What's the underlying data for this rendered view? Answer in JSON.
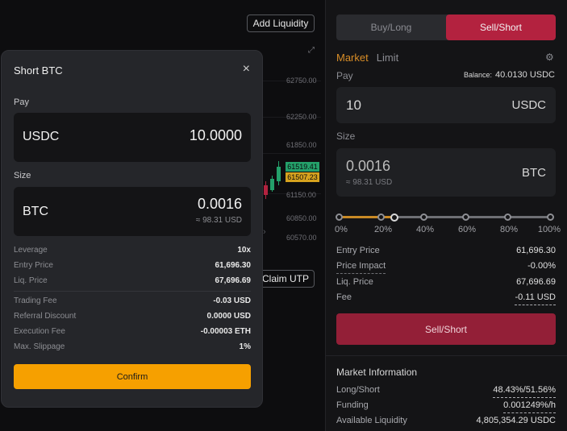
{
  "background": {
    "add_liquidity": "Add Liquidity",
    "claim_utp": "Claim UTP",
    "price_ticks": [
      "62750.00",
      "62250.00",
      "61850.00",
      "61150.00",
      "60850.00",
      "60570.00"
    ],
    "tag_green": "61519.41",
    "tag_orange": "61507.23",
    "expand_icon": "expand-icon",
    "chevron": "›"
  },
  "modal": {
    "title": "Short BTC",
    "close_icon": "×",
    "pay_label": "Pay",
    "pay_currency": "USDC",
    "pay_amount": "10.0000",
    "size_label": "Size",
    "size_currency": "BTC",
    "size_amount": "0.0016",
    "size_usd": "≈ 98.31 USD",
    "rows_a": [
      {
        "label": "Leverage",
        "value": "10x"
      },
      {
        "label": "Entry Price",
        "value": "61,696.30"
      },
      {
        "label": "Liq. Price",
        "value": "67,696.69"
      }
    ],
    "rows_b": [
      {
        "label": "Trading Fee",
        "value": "-0.03 USD"
      },
      {
        "label": "Referral Discount",
        "value": "0.0000 USD"
      },
      {
        "label": "Execution Fee",
        "value": "-0.00003 ETH"
      },
      {
        "label": "Max. Slippage",
        "value": "1%"
      }
    ],
    "confirm": "Confirm"
  },
  "trade": {
    "buy_long": "Buy/Long",
    "sell_short": "Sell/Short",
    "tab_market": "Market",
    "tab_limit": "Limit",
    "settings_icon": "⚙",
    "pay_label": "Pay",
    "balance_label": "Balance:",
    "balance_value": "40.0130 USDC",
    "pay_value": "10",
    "pay_unit": "USDC",
    "size_label": "Size",
    "size_value": "0.0016",
    "size_usd": "≈ 98.31 USD",
    "size_unit": "BTC",
    "slider_fraction": 0.26,
    "slider_labels": [
      "0%",
      "20%",
      "40%",
      "60%",
      "80%",
      "100%"
    ],
    "rows": [
      {
        "label": "Entry Price",
        "value": "61,696.30"
      },
      {
        "label": "Price Impact",
        "value": "-0.00%"
      },
      {
        "label": "Liq. Price",
        "value": "67,696.69"
      },
      {
        "label": "Fee",
        "value": "-0.11 USD"
      }
    ],
    "sell_button": "Sell/Short",
    "market_info_title": "Market Information",
    "market_rows": [
      {
        "label": "Long/Short",
        "value": "48.43%/51.56%"
      },
      {
        "label": "Funding",
        "value": "0.001249%/h"
      },
      {
        "label": "Available Liquidity",
        "value": "4,805,354.29 USDC"
      }
    ]
  },
  "colors": {
    "accent_orange": "#f6a000",
    "sell_red": "#931f37",
    "buy_green": "#24a06a"
  }
}
